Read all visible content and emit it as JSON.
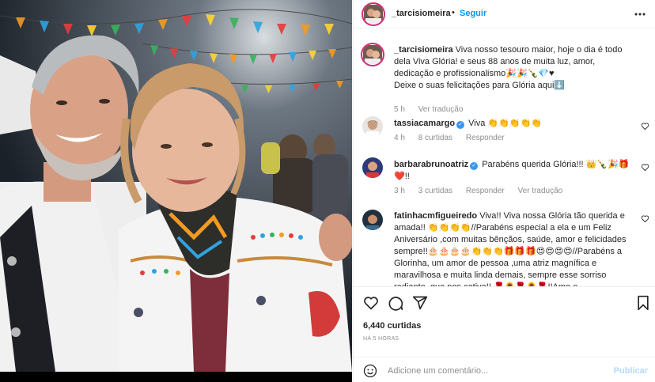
{
  "post": {
    "username": "_tarcisiomeira",
    "follow_label": "Seguir",
    "header_dot": "•",
    "caption_lines": [
      "Viva nosso tesouro maior, hoje o dia é todo",
      "dela Viva Glória! e seus 88 anos de muita luz, amor,",
      "dedicação e profissionalismo🎉🎉🍾💎♥",
      "Deixe o suas felicitações para Glória aqui⬇️"
    ],
    "caption_time": "5 h",
    "caption_translate": "Ver tradução",
    "likes": "6,440 curtidas",
    "posted_ago": "HÁ 5 HORAS"
  },
  "comments": [
    {
      "username": "tassiacamargo",
      "verified": true,
      "text": "Viva 👏👏👏👏👏",
      "time": "4 h",
      "likes": "8 curtidas",
      "reply": "Responder",
      "translate": ""
    },
    {
      "username": "barbarabrunoatriz",
      "verified": true,
      "text": "Parabéns querida Glória!!! 👑🍾🎉🎁❤️!!",
      "time": "3 h",
      "likes": "3 curtidas",
      "reply": "Responder",
      "translate": "Ver tradução"
    },
    {
      "username": "fatinhacmfigueiredo",
      "verified": false,
      "text": "Viva!! Viva nossa Glória tão querida e amada!! 👏👏👏👏//Parabéns especial a ela e um Feliz Aniversário ,com muitas bênçãos, saúde, amor e felicidades sempre!!🎂🎂🎂🎂👏👏👏🎁🎁🎁😍😍😍😍//Parabéns a Glorinha, um amor de pessoa ,uma atriz magnífica e maravilhosa e muita linda demais, sempre esse sorriso radiante, que nos cativa!! 🌹🌻🌹🌻🌹!!Amo e",
      "time": "",
      "likes": "",
      "reply": "",
      "translate": ""
    }
  ],
  "composer": {
    "placeholder": "Adicione um comentário...",
    "publish_label": "Publicar"
  },
  "colors": {
    "accent": "#0095f6",
    "verified": "#3897f0",
    "muted": "#8e8e8e",
    "publish_disabled": "#b3dbff"
  },
  "icons": [
    "more-options-icon",
    "like-heart-icon",
    "comment-icon",
    "share-icon",
    "save-bookmark-icon",
    "emoji-icon",
    "verified-badge-icon"
  ]
}
